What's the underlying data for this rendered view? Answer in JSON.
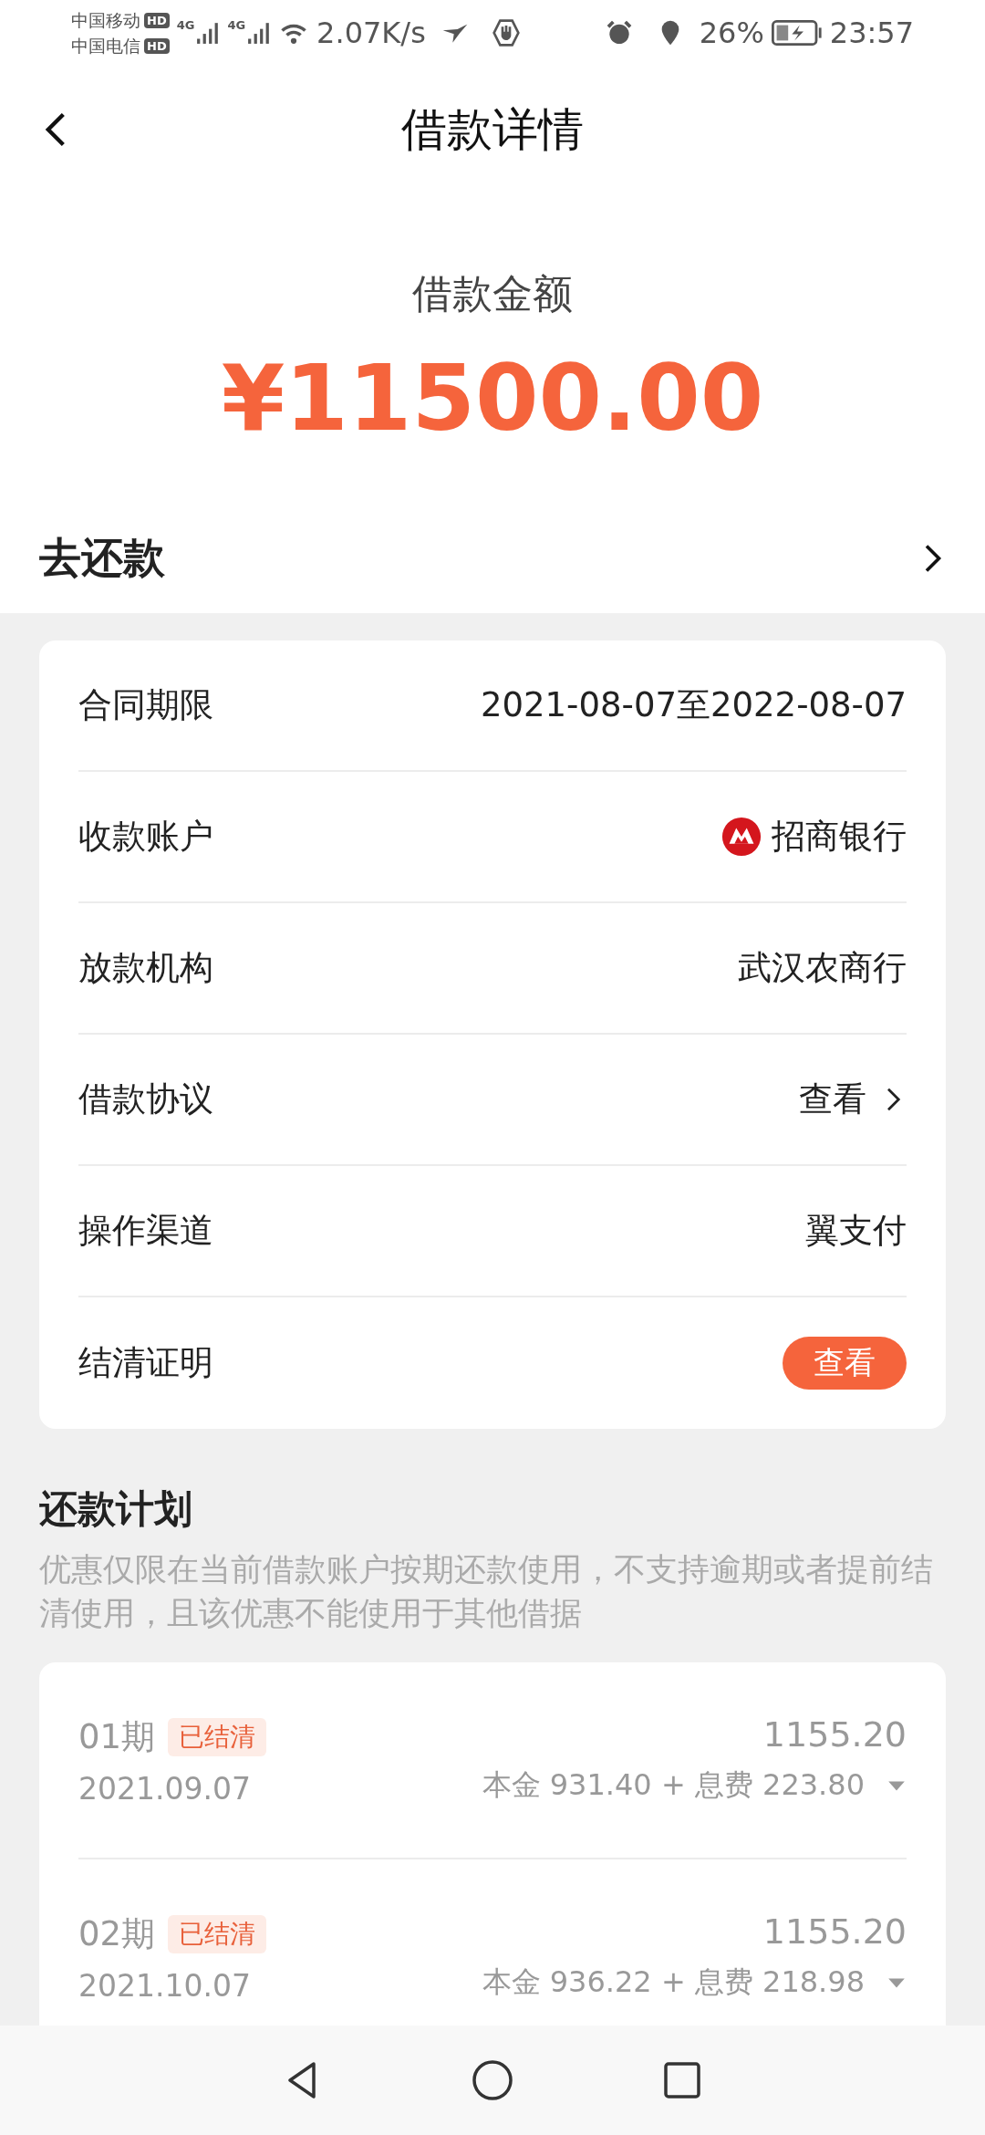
{
  "status_bar": {
    "carrier_1": "中国移动",
    "carrier_2": "中国电信",
    "hd_1": "HD",
    "hd_2": "HD",
    "network_1": "4G",
    "network_2": "4G",
    "speed": "2.07K/s",
    "battery": "26%",
    "time": "23:57"
  },
  "header": {
    "title": "借款详情"
  },
  "loan": {
    "label": "借款金额",
    "amount": "¥11500.00"
  },
  "repay_link": {
    "label": "去还款"
  },
  "details": [
    {
      "kind": "text",
      "label": "合同期限",
      "value": "2021-08-07至2022-08-07"
    },
    {
      "kind": "bank",
      "label": "收款账户",
      "value": "招商银行"
    },
    {
      "kind": "text",
      "label": "放款机构",
      "value": "武汉农商行"
    },
    {
      "kind": "link",
      "label": "借款协议",
      "value": "查看"
    },
    {
      "kind": "text",
      "label": "操作渠道",
      "value": "翼支付"
    },
    {
      "kind": "button",
      "label": "结清证明",
      "value": "查看"
    }
  ],
  "plan": {
    "title": "还款计划",
    "note": "优惠仅限在当前借款账户按期还款使用，不支持逾期或者提前结清使用，且该优惠不能使用于其他借据",
    "installments": [
      {
        "period": "01期",
        "status": "已结清",
        "date": "2021.09.07",
        "amount": "1155.20",
        "breakdown": "本金 931.40 + 息费 223.80",
        "expanded": false
      },
      {
        "period": "02期",
        "status": "已结清",
        "date": "2021.10.07",
        "amount": "1155.20",
        "breakdown": "本金 936.22 + 息费 218.98",
        "expanded": false
      }
    ]
  }
}
